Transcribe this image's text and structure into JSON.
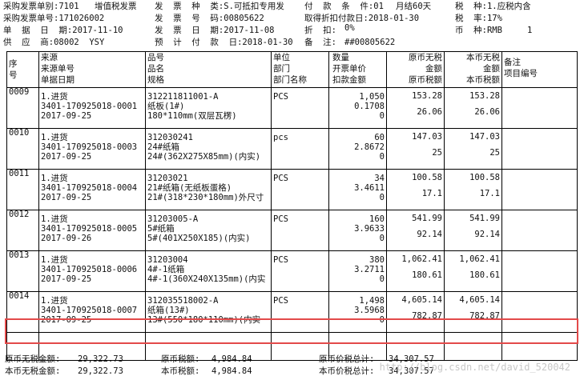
{
  "header": {
    "r1": {
      "code": "采购发票单别:7101",
      "type": "增值税发票",
      "kind": "发  票  种  类:S.可抵扣专用发",
      "terms": "付  款  条  件:01",
      "terms_val": "月结60天",
      "tax": "税  种:1.应税内含"
    },
    "r2": {
      "inv_no": "采购发票单号:171026002",
      "inv_num": "发  票  号  码:00805622",
      "deduct": "取得折扣付款日:2018-01-30",
      "rate": "税  率:17%"
    },
    "r3": {
      "date": "单  据  日  期:2017-11-10",
      "inv_date": "发  票  日  期:2017-11-08",
      "disc": "折  扣:",
      "disc_val": "0%",
      "cur": "币  种:RMB",
      "cur_rate": "1"
    },
    "r4": {
      "vendor": "供  应  商:08002  YSY",
      "pay": "预  计  付  款  日:2018-01-30",
      "note": "备  注:",
      "note_val": "##00805622"
    }
  },
  "columns": {
    "seq": [
      "序",
      "号"
    ],
    "src": [
      "来源",
      "来源单号",
      "单据日期"
    ],
    "item": [
      "品号",
      "品名",
      "规格"
    ],
    "unit": [
      "单位",
      "部门",
      "部门名称"
    ],
    "qty": [
      "数量",
      "开票单价",
      "扣款金额"
    ],
    "orig": [
      "原币无税",
      "金额",
      "原币税额"
    ],
    "local": [
      "本币无税",
      "金额",
      "本币税额"
    ],
    "memo": [
      "备注",
      "项目编号"
    ]
  },
  "rows": [
    {
      "seq": "0009",
      "src_type": "1.进货",
      "src_no": "3401-170925018-0001",
      "src_date": "2017-09-25",
      "code": "312211811001-A",
      "name": "纸板(1#)",
      "spec": "180*110mm(双层瓦楞)",
      "unit": "PCS",
      "qty": "1,050",
      "price": "0.1708",
      "deduct": "0",
      "orig_amt": "153.28",
      "orig_tax": "26.06",
      "local_amt": "153.28",
      "local_tax": "26.06"
    },
    {
      "seq": "0010",
      "src_type": "1.进货",
      "src_no": "3401-170925018-0003",
      "src_date": "2017-09-25",
      "code": "312030241",
      "name": "24#纸箱",
      "spec": "24#(362X275X85mm)(内实)",
      "unit": "pcs",
      "qty": "60",
      "price": "2.8672",
      "deduct": "0",
      "orig_amt": "147.03",
      "orig_tax": "25",
      "local_amt": "147.03",
      "local_tax": "25"
    },
    {
      "seq": "0011",
      "src_type": "1.进货",
      "src_no": "3401-170925018-0004",
      "src_date": "2017-09-25",
      "code": "31203021",
      "name": "21#纸箱(无纸板蛋格)",
      "spec": "21#(318*230*180mm)外尺寸",
      "unit": "PCS",
      "qty": "34",
      "price": "3.4611",
      "deduct": "0",
      "orig_amt": "100.58",
      "orig_tax": "17.1",
      "local_amt": "100.58",
      "local_tax": "17.1"
    },
    {
      "seq": "0012",
      "src_type": "1.进货",
      "src_no": "3401-170925018-0005",
      "src_date": "2017-09-26",
      "code": "31203005-A",
      "name": "5#纸箱",
      "spec": "5#(401X250X185)(内实)",
      "unit": "PCS",
      "qty": "160",
      "price": "3.9633",
      "deduct": "0",
      "orig_amt": "541.99",
      "orig_tax": "92.14",
      "local_amt": "541.99",
      "local_tax": "92.14"
    },
    {
      "seq": "0013",
      "src_type": "1.进货",
      "src_no": "3401-170925018-0006",
      "src_date": "2017-09-25",
      "code": "31203004",
      "name": "4#-1纸箱",
      "spec": "4#-1(360X240X135mm)(内实",
      "unit": "PCS",
      "qty": "380",
      "price": "3.2711",
      "deduct": "0",
      "orig_amt": "1,062.41",
      "orig_tax": "180.61",
      "local_amt": "1,062.41",
      "local_tax": "180.61"
    },
    {
      "seq": "0014",
      "src_type": "1.进货",
      "src_no": "3401-170925018-0007",
      "src_date": "2017-09-25",
      "code": "312035518002-A",
      "name": "纸箱(13#)",
      "spec": "13#(550*180*110mm)(内实",
      "unit": "PCS",
      "qty": "1,498",
      "price": "3.5968",
      "deduct": "0",
      "orig_amt": "4,605.14",
      "orig_tax": "782.87",
      "local_amt": "4,605.14",
      "local_tax": "782.87"
    }
  ],
  "footer": {
    "r1": {
      "a_label": "原币无税金额:",
      "a_val": "29,322.73",
      "b_label": "原币税额:",
      "b_val": "4,984.84",
      "c_label": "原币价税总计:",
      "c_val": "34,307.57"
    },
    "r2": {
      "a_label": "本币无税金额:",
      "a_val": "29,322.73",
      "b_label": "本币税额:",
      "b_val": "4,984.84",
      "c_label": "本币价税总计:",
      "c_val": "34,307.57"
    }
  },
  "watermark": "http://blog.csdn.net/david_520042",
  "highlight_color": "#e34a4a"
}
